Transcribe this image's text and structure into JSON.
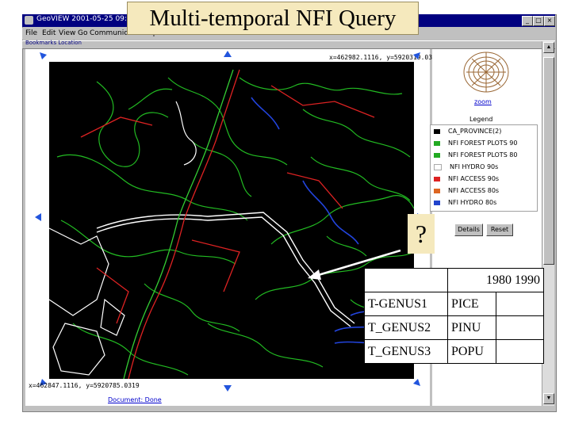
{
  "slide": {
    "title": "Multi-temporal NFI Query",
    "question_mark": "?"
  },
  "window": {
    "title": "GeoVIEW 2001-05-25 09:47:48",
    "controls": [
      "_",
      "□",
      "×"
    ]
  },
  "menu": [
    "File",
    "Edit",
    "View",
    "Go",
    "Communicator",
    "Help"
  ],
  "toolbar": {
    "text": "Bookmarks  Location"
  },
  "map": {
    "coords_top": "x=462982.1116, y=5920319.0319",
    "coords_bottom": "x=462847.1116, y=5920785.0319",
    "status_link": "Document: Done",
    "nav_arrows": [
      "north",
      "south",
      "west",
      "east",
      "northwest",
      "northeast",
      "southwest",
      "southeast"
    ]
  },
  "panel": {
    "zoom_link": "zoom",
    "legend_label": "Legend",
    "legend_items": [
      {
        "label": "CA_PROVINCE(2)",
        "color": "#000000"
      },
      {
        "label": "NFI FOREST PLOTS 90",
        "color": "#22aa22"
      },
      {
        "label": "NFI FOREST PLOTS 80",
        "color": "#22aa22"
      },
      {
        "label": "NFI HYDRO 90s",
        "color": "#ffffff"
      },
      {
        "label": "NFI ACCESS 90s",
        "color": "#dd2222"
      },
      {
        "label": "NFI ACCESS 80s",
        "color": "#dd6622"
      },
      {
        "label": "NFI HYDRO 80s",
        "color": "#2244cc"
      }
    ],
    "buttons": {
      "details": "Details",
      "reset": "Reset"
    }
  },
  "genus_table": {
    "years": "1980  1990",
    "rows": [
      {
        "field": "T-GENUS1",
        "v1980": "PICE",
        "v1990": ""
      },
      {
        "field": "T_GENUS2",
        "v1980": "PINU",
        "v1990": ""
      },
      {
        "field": "T_GENUS3",
        "v1980": "POPU",
        "v1990": ""
      }
    ]
  },
  "colors": {
    "title_bg": "#f5e9bd",
    "titlebar": "#000080",
    "map_bg": "#000000",
    "forest_lines": "#22bb22",
    "roads": "#dd2222",
    "hydro": "#2244dd",
    "access": "#ffffff"
  }
}
